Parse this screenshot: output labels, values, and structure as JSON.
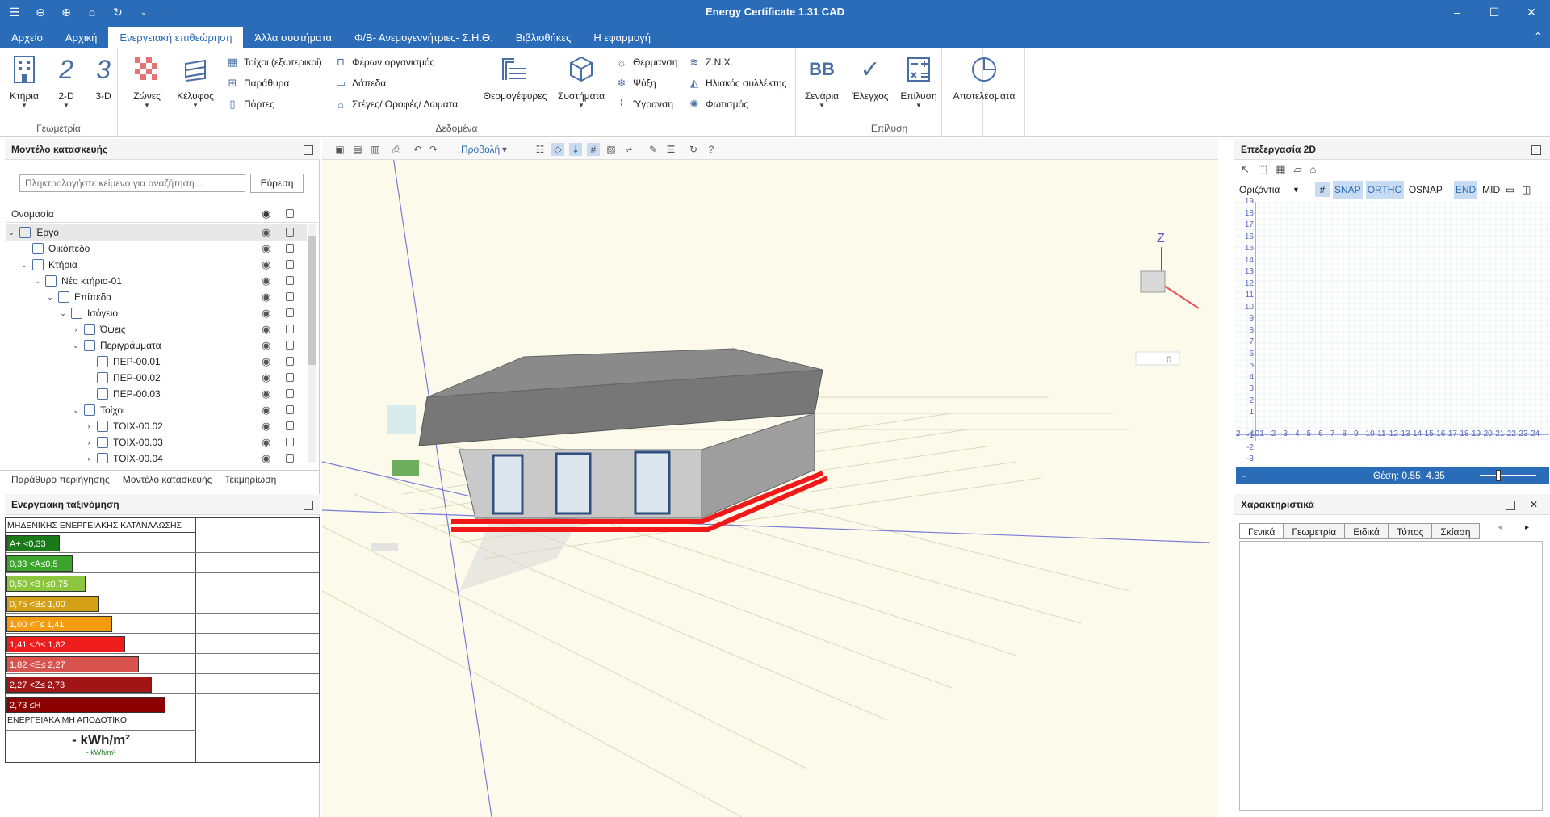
{
  "app": {
    "title": "Energy Certificate 1.31 CAD"
  },
  "menu": [
    "Αρχείο",
    "Αρχική",
    "Ενεργειακή επιθεώρηση",
    "Άλλα συστήματα",
    "Φ/Β- Ανεμογεννήτριες- Σ.Η.Θ.",
    "Βιβλιοθήκες",
    "Η εφαρμογή"
  ],
  "ribbon": {
    "geometry": {
      "label": "Γεωμετρία",
      "buildings": "Κτήρια",
      "d2": "2-D",
      "d3": "3-D"
    },
    "data": {
      "label": "Δεδομένα",
      "zones": "Ζώνες",
      "envelope": "Κέλυφος",
      "walls": "Τοίχοι (εξωτερικοί)",
      "windows": "Παράθυρα",
      "doors": "Πόρτες",
      "bearing": "Φέρων οργανισμός",
      "floors": "Δάπεδα",
      "roofs": "Στέγες/ Οροφές/ Δώματα",
      "thermal_bridges": "Θερμογέφυρες",
      "systems": "Συστήματα",
      "heating": "Θέρμανση",
      "cooling": "Ψύξη",
      "humid": "Ύγρανση",
      "dhw": "Ζ.Ν.Χ.",
      "solar": "Ηλιακός συλλέκτης",
      "lighting": "Φωτισμός"
    },
    "solve": {
      "label": "Επίλυση",
      "scenarios": "Σενάρια",
      "checks": "Έλεγχος",
      "solve": "Επίλυση"
    },
    "results": "Αποτελέσματα"
  },
  "left": {
    "title": "Μοντέλο κατασκευής",
    "search_placeholder": "Πληκτρολογήστε κείμενο για αναζήτηση...",
    "search_btn": "Εύρεση",
    "col_name": "Ονομασία",
    "tree": [
      {
        "label": "Έργο",
        "level": 0,
        "exp": "v",
        "sel": true
      },
      {
        "label": "Οικόπεδο",
        "level": 1,
        "exp": ""
      },
      {
        "label": "Κτήρια",
        "level": 1,
        "exp": "v"
      },
      {
        "label": "Νέο κτήριο-01",
        "level": 2,
        "exp": "v"
      },
      {
        "label": "Επίπεδα",
        "level": 3,
        "exp": "v"
      },
      {
        "label": "Ισόγειο",
        "level": 4,
        "exp": "v"
      },
      {
        "label": "Όψεις",
        "level": 5,
        "exp": ">"
      },
      {
        "label": "Περιγράμματα",
        "level": 5,
        "exp": "v"
      },
      {
        "label": "ΠΕΡ-00.01",
        "level": 6,
        "exp": ""
      },
      {
        "label": "ΠΕΡ-00.02",
        "level": 6,
        "exp": ""
      },
      {
        "label": "ΠΕΡ-00.03",
        "level": 6,
        "exp": ""
      },
      {
        "label": "Τοίχοι",
        "level": 5,
        "exp": "v"
      },
      {
        "label": "ΤΟΙΧ-00.02",
        "level": 6,
        "exp": ">"
      },
      {
        "label": "ΤΟΙΧ-00.03",
        "level": 6,
        "exp": ">"
      },
      {
        "label": "ΤΟΙΧ-00.04",
        "level": 6,
        "exp": ">"
      }
    ],
    "tabs": [
      "Παράθυρο περιήγησης",
      "Μοντέλο κατασκευής",
      "Τεκμηρίωση"
    ]
  },
  "energy": {
    "title": "Ενεργειακή ταξινόμηση",
    "header": "ΜΗΔΕΝΙΚΗΣ ΕΝΕΡΓΕΙΑΚΗΣ ΚΑΤΑΝΑΛΩΣΗΣ",
    "classes": [
      {
        "label": "A+ <0,33",
        "color": "#1a7a1a",
        "width": 0.28
      },
      {
        "label": "0,33 <A≤0,5",
        "color": "#3aa52a",
        "width": 0.35
      },
      {
        "label": "0,50 <B+≤0,75",
        "color": "#8cc63f",
        "width": 0.42
      },
      {
        "label": "0,75 <B≤ 1,00",
        "color": "#d4a017",
        "width": 0.49
      },
      {
        "label": "1,00 <Γ≤ 1,41",
        "color": "#f39c12",
        "width": 0.56
      },
      {
        "label": "1,41 <Δ≤ 1,82",
        "color": "#ee1c1c",
        "width": 0.63
      },
      {
        "label": "1,82 <Ε≤ 2,27",
        "color": "#d9534f",
        "width": 0.7
      },
      {
        "label": "2,27 <Ζ≤ 2,73",
        "color": "#a01515",
        "width": 0.77
      },
      {
        "label": "2,73 ≤Η",
        "color": "#8b0000",
        "width": 0.84
      }
    ],
    "footer": "ΕΝΕΡΓΕΙΑΚΑ ΜΗ ΑΠΟΔΟΤΙΚΟ",
    "value": "-",
    "unit": "kWh/m²",
    "sub_value": "-",
    "sub_unit": "kWh/m²"
  },
  "view3d": {
    "dropdown": "Προβολή",
    "angle_value": "0"
  },
  "editor2d": {
    "title": "Επεξεργασία 2D",
    "plane": "Οριζόντια",
    "snaps": [
      "SNAP",
      "ORTHO",
      "OSNAP",
      "END",
      "MID"
    ],
    "position": "Θέση: 0.55: 4.35",
    "y_ticks": [
      "19",
      "18",
      "17",
      "16",
      "15",
      "14",
      "13",
      "12",
      "11",
      "10",
      "9",
      "8",
      "7",
      "6",
      "5",
      "4",
      "3",
      "2",
      "1",
      "-1",
      "-2",
      "-3"
    ],
    "x_ticks": [
      "2",
      "-10",
      "1",
      "2",
      "3",
      "4",
      "5",
      "6",
      "7",
      "8",
      "9",
      "10",
      "11",
      "12",
      "13",
      "14",
      "15",
      "16",
      "17",
      "18",
      "19",
      "20",
      "21",
      "22",
      "23",
      "24"
    ]
  },
  "properties": {
    "title": "Χαρακτηριστικά",
    "tabs": [
      "Γενικά",
      "Γεωμετρία",
      "Ειδικά",
      "Τύπος",
      "Σκίαση"
    ]
  }
}
